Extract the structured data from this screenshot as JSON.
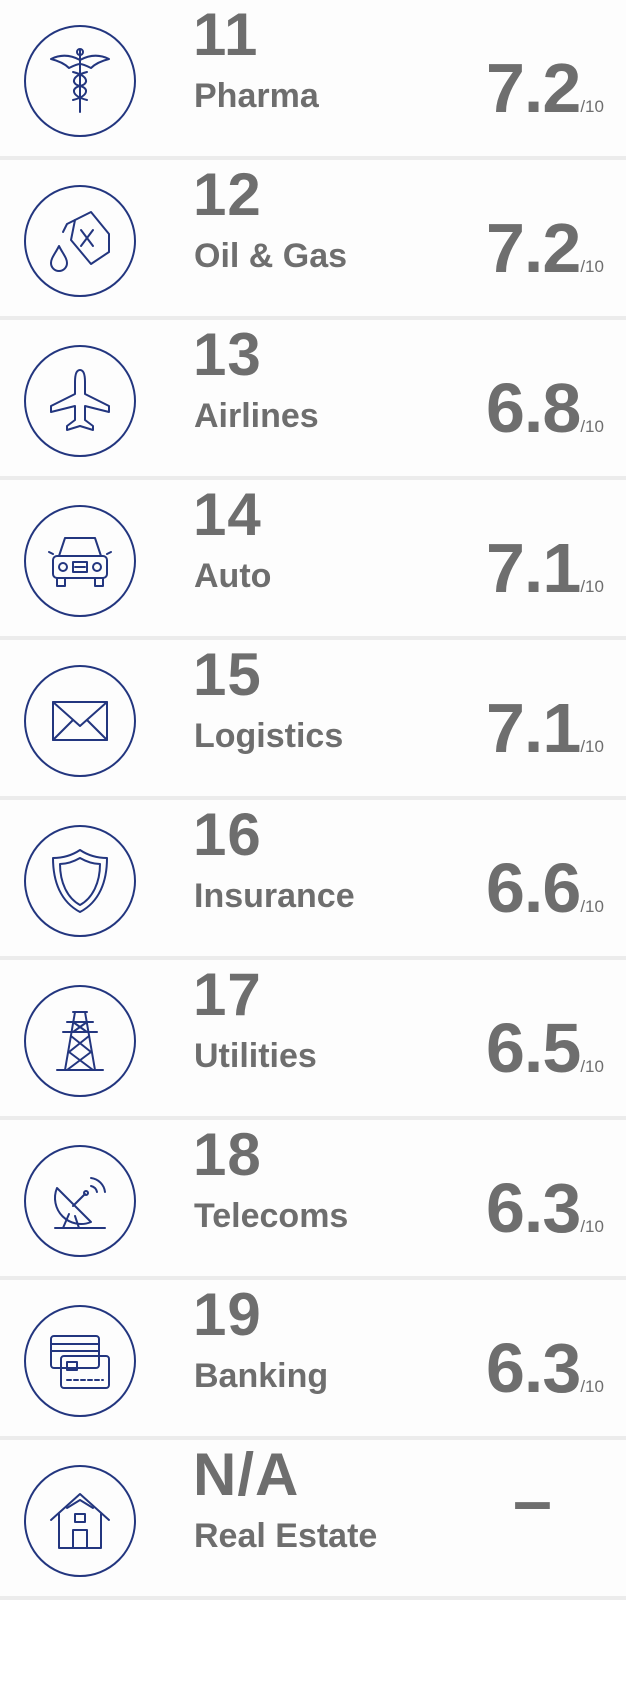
{
  "rows": [
    {
      "rank": "11",
      "sector": "Pharma",
      "score": "7.2",
      "out_of": "/10",
      "icon": "caduceus-icon"
    },
    {
      "rank": "12",
      "sector": "Oil & Gas",
      "score": "7.2",
      "out_of": "/10",
      "icon": "fuel-can-icon"
    },
    {
      "rank": "13",
      "sector": "Airlines",
      "score": "6.8",
      "out_of": "/10",
      "icon": "airplane-icon"
    },
    {
      "rank": "14",
      "sector": "Auto",
      "score": "7.1",
      "out_of": "/10",
      "icon": "car-icon"
    },
    {
      "rank": "15",
      "sector": "Logistics",
      "score": "7.1",
      "out_of": "/10",
      "icon": "envelope-icon"
    },
    {
      "rank": "16",
      "sector": "Insurance",
      "score": "6.6",
      "out_of": "/10",
      "icon": "shield-icon"
    },
    {
      "rank": "17",
      "sector": "Utilities",
      "score": "6.5",
      "out_of": "/10",
      "icon": "power-pylon-icon"
    },
    {
      "rank": "18",
      "sector": "Telecoms",
      "score": "6.3",
      "out_of": "/10",
      "icon": "satellite-dish-icon"
    },
    {
      "rank": "19",
      "sector": "Banking",
      "score": "6.3",
      "out_of": "/10",
      "icon": "credit-cards-icon"
    },
    {
      "rank": "N/A",
      "sector": "Real Estate",
      "score": "–",
      "out_of": "",
      "icon": "house-icon"
    }
  ],
  "colors": {
    "icon_stroke": "#23367f",
    "text": "#6e6e6e",
    "divider": "#ececec"
  }
}
